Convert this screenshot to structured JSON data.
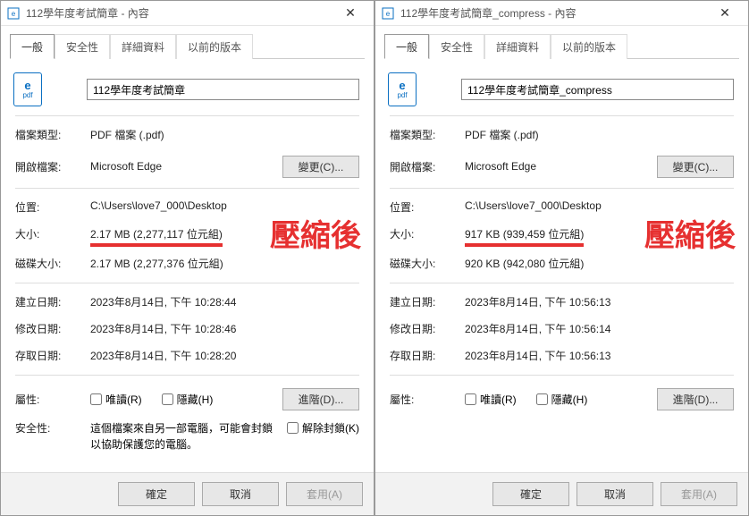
{
  "left": {
    "title": "112學年度考試簡章 - 內容",
    "tabs": [
      "一般",
      "安全性",
      "詳細資料",
      "以前的版本"
    ],
    "filename": "112學年度考試簡章",
    "fields": {
      "type_label": "檔案類型:",
      "type_value": "PDF 檔案 (.pdf)",
      "opens_label": "開啟檔案:",
      "opens_value": "Microsoft Edge",
      "change_btn": "變更(C)...",
      "location_label": "位置:",
      "location_value": "C:\\Users\\love7_000\\Desktop",
      "size_label": "大小:",
      "size_value": "2.17 MB (2,277,117 位元組)",
      "disk_label": "磁碟大小:",
      "disk_value": "2.17 MB (2,277,376 位元組)",
      "created_label": "建立日期:",
      "created_value": "2023年8月14日, 下午 10:28:44",
      "modified_label": "修改日期:",
      "modified_value": "2023年8月14日, 下午 10:28:46",
      "accessed_label": "存取日期:",
      "accessed_value": "2023年8月14日, 下午 10:28:20",
      "attrs_label": "屬性:",
      "readonly_label": "唯讀(R)",
      "hidden_label": "隱藏(H)",
      "advanced_btn": "進階(D)...",
      "security_label": "安全性:",
      "security_text": "這個檔案來自另一部電腦，可能會封鎖以協助保護您的電腦。",
      "unblock_label": "解除封鎖(K)"
    },
    "overlay": "壓縮後"
  },
  "right": {
    "title": "112學年度考試簡章_compress - 內容",
    "tabs": [
      "一般",
      "安全性",
      "詳細資料",
      "以前的版本"
    ],
    "filename": "112學年度考試簡章_compress",
    "fields": {
      "type_label": "檔案類型:",
      "type_value": "PDF 檔案 (.pdf)",
      "opens_label": "開啟檔案:",
      "opens_value": "Microsoft Edge",
      "change_btn": "變更(C)...",
      "location_label": "位置:",
      "location_value": "C:\\Users\\love7_000\\Desktop",
      "size_label": "大小:",
      "size_value": "917 KB (939,459 位元組)",
      "disk_label": "磁碟大小:",
      "disk_value": "920 KB (942,080 位元組)",
      "created_label": "建立日期:",
      "created_value": "2023年8月14日, 下午 10:56:13",
      "modified_label": "修改日期:",
      "modified_value": "2023年8月14日, 下午 10:56:14",
      "accessed_label": "存取日期:",
      "accessed_value": "2023年8月14日, 下午 10:56:13",
      "attrs_label": "屬性:",
      "readonly_label": "唯讀(R)",
      "hidden_label": "隱藏(H)",
      "advanced_btn": "進階(D)..."
    },
    "overlay": "壓縮後"
  },
  "footer": {
    "ok": "確定",
    "cancel": "取消",
    "apply": "套用(A)"
  }
}
